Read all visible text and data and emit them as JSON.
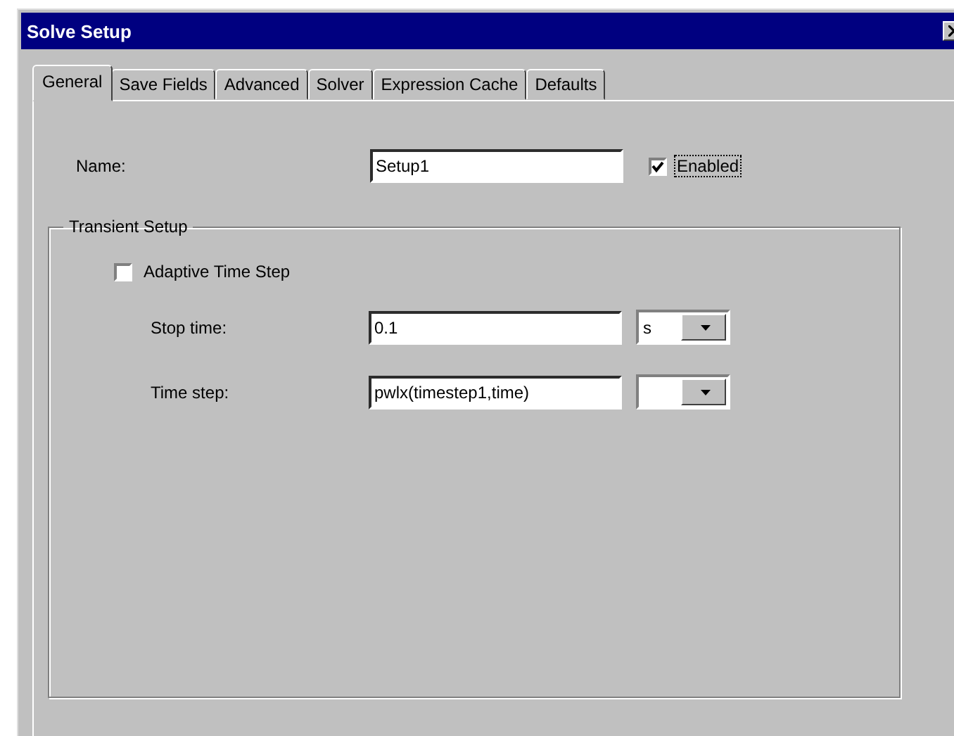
{
  "window": {
    "title": "Solve Setup"
  },
  "tabs": [
    {
      "label": "General",
      "selected": true
    },
    {
      "label": "Save Fields",
      "selected": false
    },
    {
      "label": "Advanced",
      "selected": false
    },
    {
      "label": "Solver",
      "selected": false
    },
    {
      "label": "Expression Cache",
      "selected": false
    },
    {
      "label": "Defaults",
      "selected": false
    }
  ],
  "name_field": {
    "label": "Name:",
    "value": "Setup1"
  },
  "enabled": {
    "label": "Enabled",
    "checked": true
  },
  "transient_setup": {
    "title": "Transient Setup",
    "adaptive_time_step": {
      "label": "Adaptive Time Step",
      "checked": false
    },
    "rows": [
      {
        "label": "Stop time:",
        "value": "0.1",
        "unit": "s"
      },
      {
        "label": "Time step:",
        "value": "pwlx(timestep1,time)"
      }
    ]
  }
}
